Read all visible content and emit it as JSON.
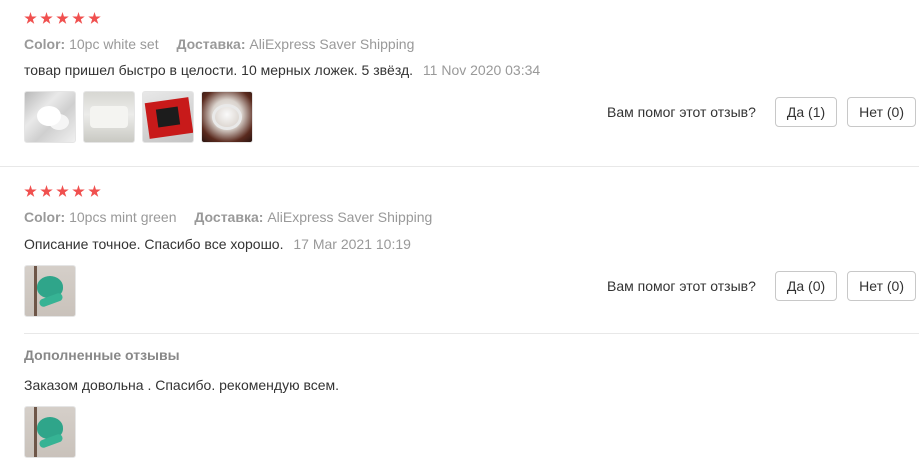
{
  "reviews": [
    {
      "rating": 5,
      "color_label": "Color:",
      "color_value": "10pc white set",
      "delivery_label": "Доставка:",
      "delivery_value": "AliExpress Saver Shipping",
      "text": "товар пришел быстро в целости. 10 мерных ложек. 5 звёзд.",
      "date": "11 Nov 2020 03:34",
      "helpful_question": "Вам помог этот отзыв?",
      "yes_label": "Да (1)",
      "no_label": "Нет (0)"
    },
    {
      "rating": 5,
      "color_label": "Color:",
      "color_value": "10pcs mint green",
      "delivery_label": "Доставка:",
      "delivery_value": "AliExpress Saver Shipping",
      "text": "Описание точное. Спасибо все хорошо.",
      "date": "17 Mar 2021 10:19",
      "helpful_question": "Вам помог этот отзыв?",
      "yes_label": "Да (0)",
      "no_label": "Нет (0)"
    }
  ],
  "additional": {
    "title": "Дополненные отзывы",
    "text": "Заказом довольна . Спасибо. рекомендую всем."
  },
  "colors": {
    "star": "#f0504f",
    "muted_text": "#999999",
    "body_text": "#333333",
    "divider": "#e8e8e8"
  }
}
